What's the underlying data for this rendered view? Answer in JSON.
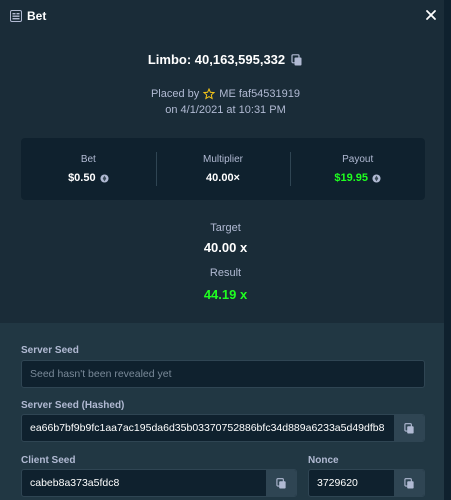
{
  "header": {
    "title": "Bet"
  },
  "bet": {
    "title": "Limbo: 40,163,595,332",
    "placed_by_prefix": "Placed by",
    "placed_by_user": "ME faf54531919",
    "date": "on 4/1/2021 at 10:31 PM"
  },
  "stats": {
    "bet_label": "Bet",
    "bet_value": "$0.50",
    "multiplier_label": "Multiplier",
    "multiplier_value": "40.00×",
    "payout_label": "Payout",
    "payout_value": "$19.95"
  },
  "game": {
    "target_label": "Target",
    "target_value": "40.00 x",
    "result_label": "Result",
    "result_value": "44.19 x"
  },
  "fairness": {
    "server_seed_label": "Server Seed",
    "server_seed_value": "Seed hasn't been revealed yet",
    "server_seed_hashed_label": "Server Seed (Hashed)",
    "server_seed_hashed_value": "ea66b7bf9b9fc1aa7ac195da6d35b03370752886bfc34d889a6233a5d49dfb8",
    "client_seed_label": "Client Seed",
    "client_seed_value": "cabeb8a373a5fdc8",
    "nonce_label": "Nonce",
    "nonce_value": "3729620"
  },
  "colors": {
    "background": "#1a2c38",
    "panel": "#0f212e",
    "fairness_panel": "#213743",
    "green": "#1fff20",
    "muted_text": "#b1bad3"
  },
  "icons": {
    "header": "receipt-icon",
    "close": "close-icon",
    "copy": "copy-icon",
    "star": "star-icon",
    "coin": "coin-icon"
  }
}
